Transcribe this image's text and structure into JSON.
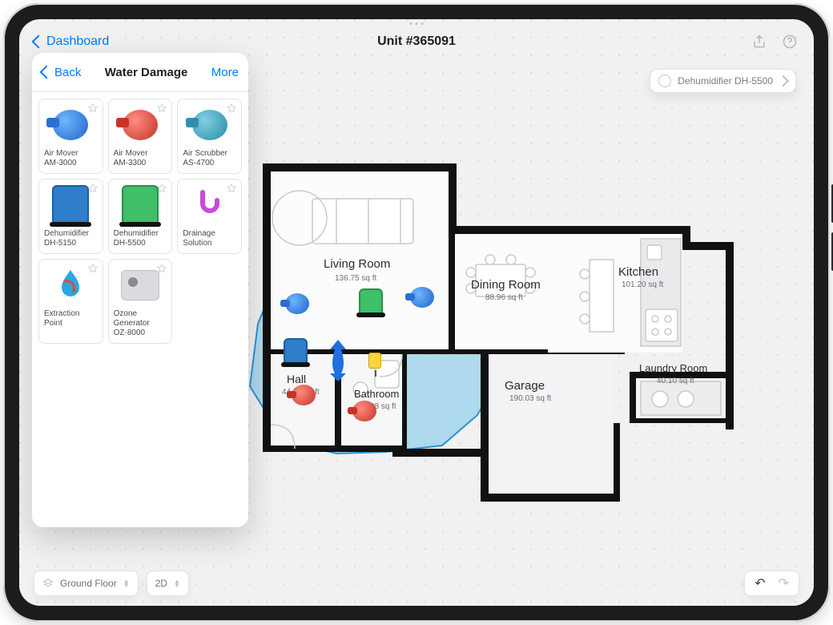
{
  "topbar": {
    "breadcrumb": "Dashboard",
    "title": "Unit #365091"
  },
  "sidepanel": {
    "back": "Back",
    "title": "Water Damage",
    "more": "More",
    "items": [
      {
        "line1": "Air Mover",
        "line2": "AM-3000",
        "icon": "blower-blue"
      },
      {
        "line1": "Air Mover",
        "line2": "AM-3300",
        "icon": "blower-red"
      },
      {
        "line1": "Air Scrubber",
        "line2": "AS-4700",
        "icon": "blower-teal"
      },
      {
        "line1": "Dehumidifier",
        "line2": "DH-5150",
        "icon": "dehumi-blue"
      },
      {
        "line1": "Dehumidifier",
        "line2": "DH-5500",
        "icon": "dehumi-green"
      },
      {
        "line1": "Drainage",
        "line2": "Solution",
        "icon": "drain"
      },
      {
        "line1": "Extraction Point",
        "line2": "",
        "icon": "drop"
      },
      {
        "line1": "Ozone Generator",
        "line2": "OZ-8000",
        "icon": "ozone"
      }
    ]
  },
  "pill": {
    "label": "Dehumidifier DH-5500"
  },
  "rooms": {
    "living": {
      "name": "Living Room",
      "area": "136.75 sq ft"
    },
    "dining": {
      "name": "Dining Room",
      "area": "88.96 sq ft"
    },
    "kitchen": {
      "name": "Kitchen",
      "area": "101.20 sq ft"
    },
    "laundry": {
      "name": "Laundry Room",
      "area": "40.10 sq ft"
    },
    "garage": {
      "name": "Garage",
      "area": "190.03 sq ft"
    },
    "bath": {
      "name": "Bathroom",
      "area": "10.28 sq ft"
    },
    "hall": {
      "name": "Hall",
      "area": "44.81 sq ft"
    }
  },
  "bottom": {
    "floor": "Ground Floor",
    "view": "2D"
  }
}
